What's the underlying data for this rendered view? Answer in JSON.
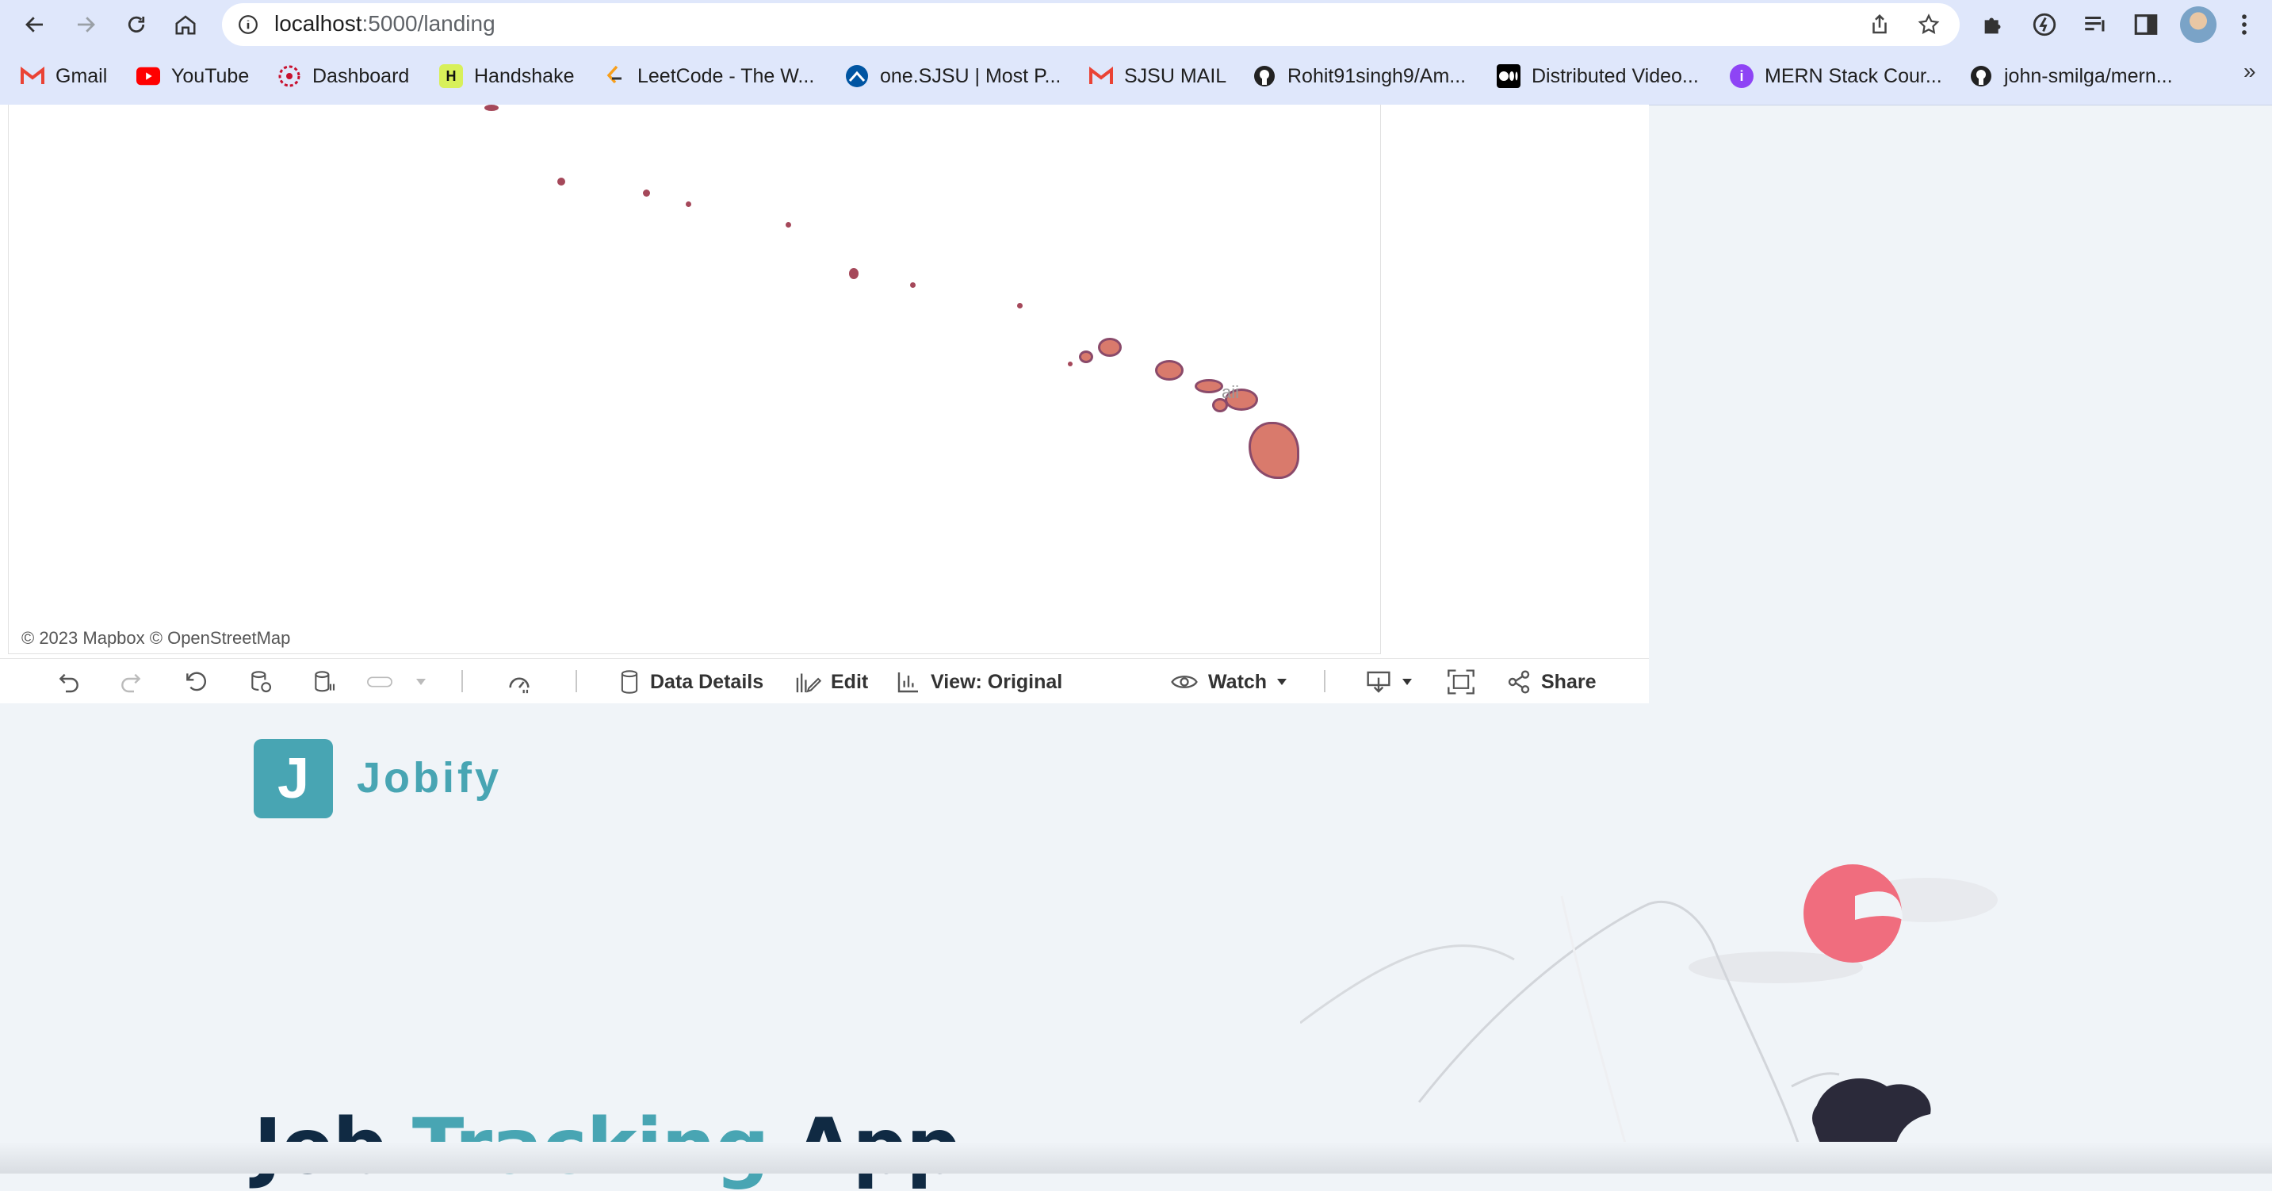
{
  "browser": {
    "url_host": "localhost",
    "url_path": ":5000/landing",
    "bookmarks": [
      {
        "label": "Gmail",
        "icon": "gmail-icon"
      },
      {
        "label": "YouTube",
        "icon": "youtube-icon"
      },
      {
        "label": "Dashboard",
        "icon": "dashboard-icon"
      },
      {
        "label": "Handshake",
        "icon": "handshake-icon"
      },
      {
        "label": "LeetCode - The W...",
        "icon": "leetcode-icon"
      },
      {
        "label": "one.SJSU | Most P...",
        "icon": "sjsu-icon"
      },
      {
        "label": "SJSU MAIL",
        "icon": "gmail-icon"
      },
      {
        "label": "Rohit91singh9/Am...",
        "icon": "github-icon"
      },
      {
        "label": "Distributed Video...",
        "icon": "medium-icon"
      },
      {
        "label": "MERN Stack Cour...",
        "icon": "course-icon"
      },
      {
        "label": "john-smilga/mern...",
        "icon": "github-icon"
      }
    ],
    "more": "»"
  },
  "map": {
    "attribution": "© 2023 Mapbox  © OpenStreetMap",
    "region_label": "aii"
  },
  "viz_toolbar": {
    "data_details": "Data Details",
    "edit": "Edit",
    "view": "View: Original",
    "watch": "Watch",
    "share": "Share"
  },
  "landing": {
    "logo_letter": "J",
    "logo_name": "Jobify",
    "title_part1": "Job ",
    "title_accent": "Tracking",
    "title_part2": " App"
  },
  "colors": {
    "brand": "#48a5b3",
    "dark": "#102a43",
    "sun": "#f06d7e",
    "island": "#a5485a"
  }
}
